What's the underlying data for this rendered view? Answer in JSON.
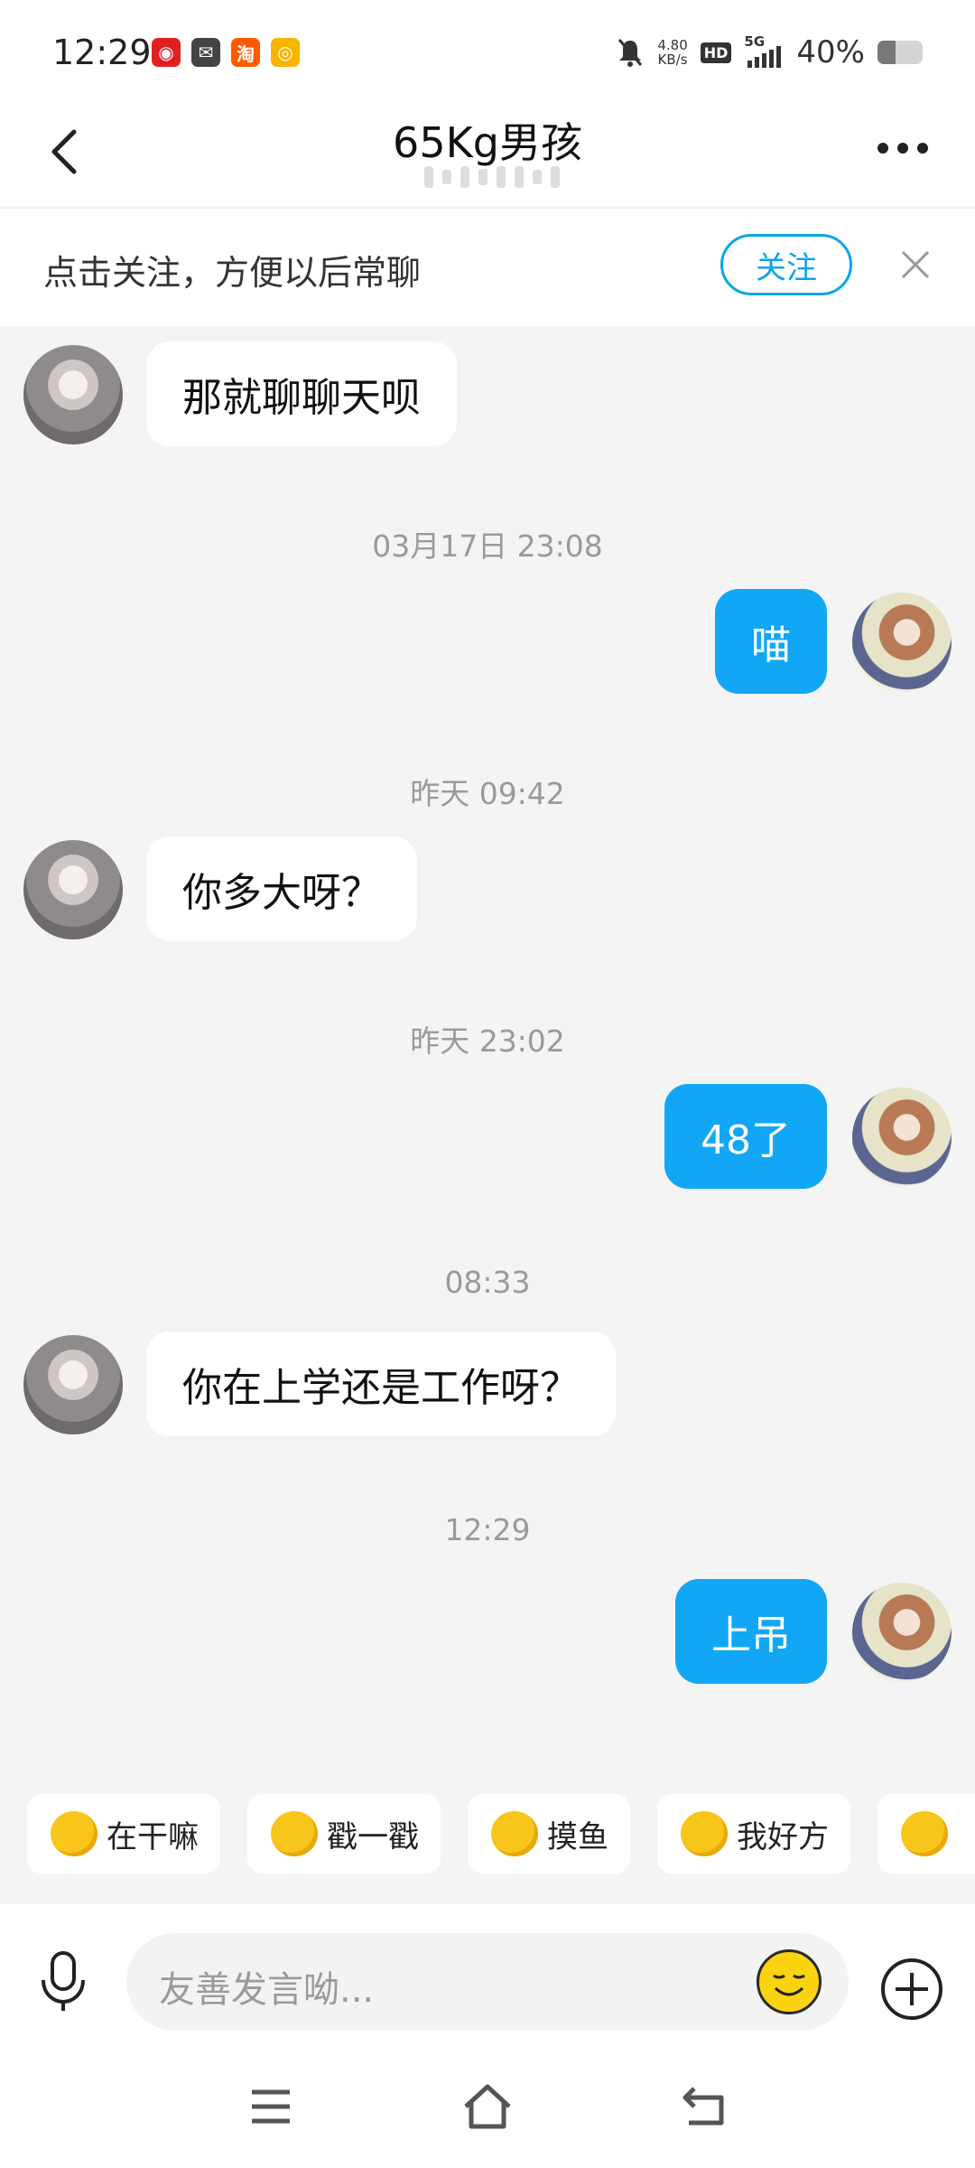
{
  "status_bar": {
    "time": "12:29",
    "app_icons": [
      {
        "name": "netease-music-icon",
        "glyph": "◉",
        "color": "#e02020"
      },
      {
        "name": "mail-icon",
        "glyph": "✉",
        "color": "#444444"
      },
      {
        "name": "taobao-icon",
        "glyph": "淘",
        "color": "#ff5a00"
      },
      {
        "name": "weibo-icon",
        "glyph": "◎",
        "color": "#f7b500"
      }
    ],
    "net_speed_value": "4.80",
    "net_speed_unit": "KB/s",
    "hd_label": "HD",
    "network_label": "5G",
    "battery_text": "40%",
    "battery_level": 0.4
  },
  "header": {
    "title": "65Kg男孩"
  },
  "follow_bar": {
    "prompt": "点击关注，方便以后常聊",
    "follow_label": "关注"
  },
  "messages": [
    {
      "kind": "msg",
      "side": "left",
      "text": "那就聊聊天呗"
    },
    {
      "kind": "time",
      "text": "03月17日 23:08"
    },
    {
      "kind": "msg",
      "side": "right",
      "text": "喵"
    },
    {
      "kind": "time",
      "text": "昨天 09:42"
    },
    {
      "kind": "msg",
      "side": "left",
      "text": "你多大呀？"
    },
    {
      "kind": "time",
      "text": "昨天 23:02"
    },
    {
      "kind": "msg",
      "side": "right",
      "text": "48了"
    },
    {
      "kind": "time",
      "text": "08:33"
    },
    {
      "kind": "msg",
      "side": "left",
      "text": "你在上学还是工作呀？"
    },
    {
      "kind": "time",
      "text": "12:29"
    },
    {
      "kind": "msg",
      "side": "right",
      "text": "上吊"
    }
  ],
  "quick_actions": [
    {
      "label": "在干嘛",
      "icon": "busy-emoji-icon"
    },
    {
      "label": "戳一戳",
      "icon": "poke-hand-icon"
    },
    {
      "label": "摸鱼",
      "icon": "slacking-emoji-icon"
    },
    {
      "label": "我好方",
      "icon": "square-emoji-icon"
    },
    {
      "label": "",
      "icon": "more-emoji-icon"
    }
  ],
  "input": {
    "placeholder": "友善发言呦..."
  }
}
